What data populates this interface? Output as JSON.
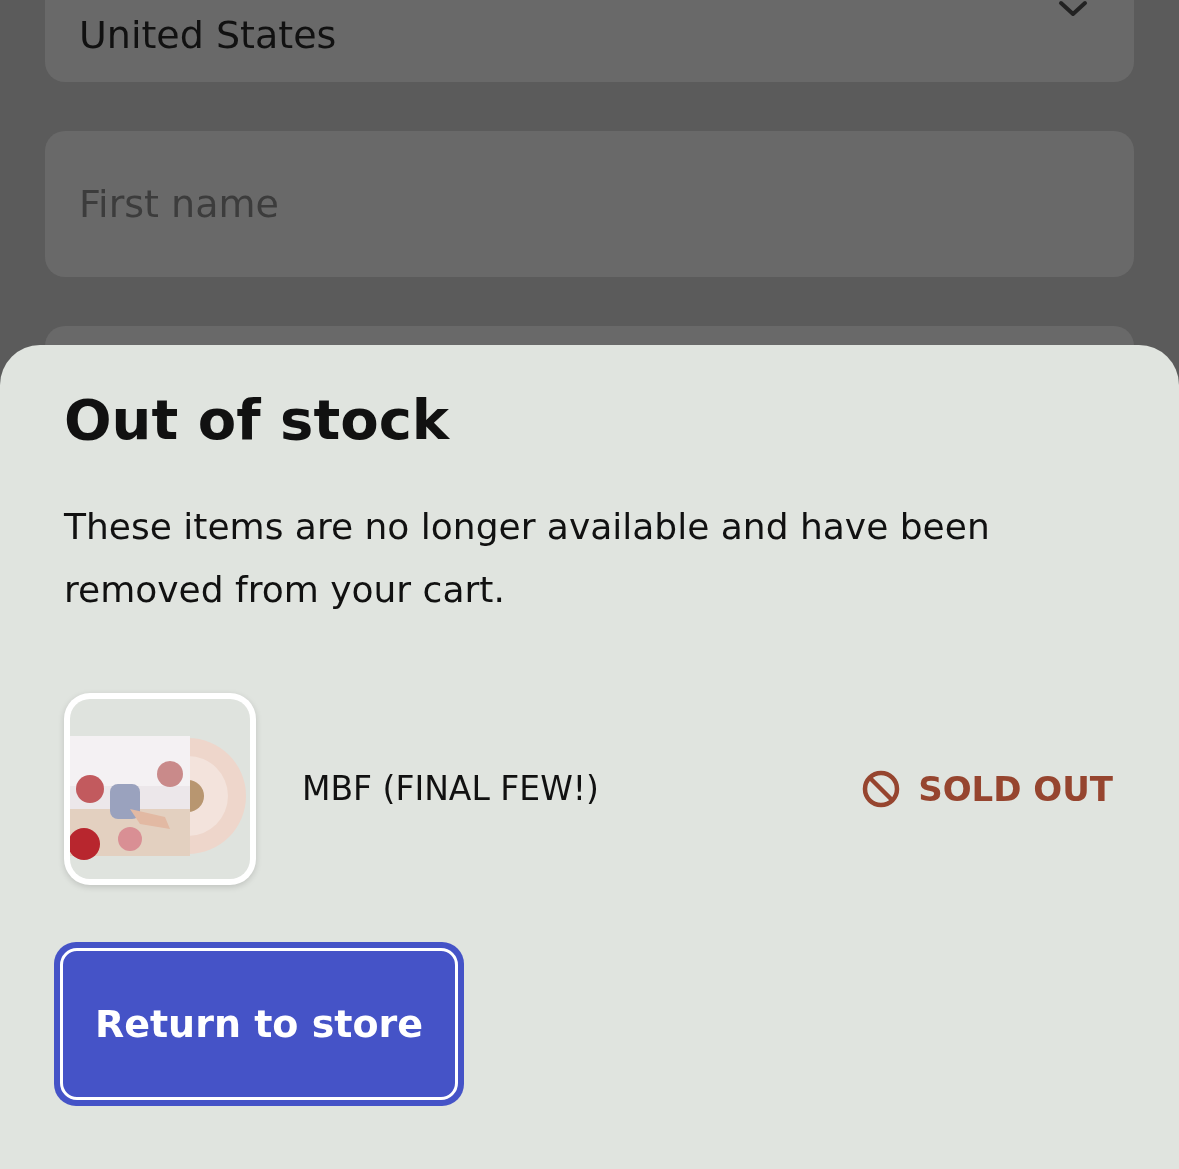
{
  "background_form": {
    "fields": [
      {
        "kind": "select",
        "value": "United States"
      },
      {
        "kind": "text",
        "placeholder": "First name"
      },
      {
        "kind": "text"
      }
    ]
  },
  "dialog": {
    "title": "Out of stock",
    "message": "These items are no longer available and have been removed from your cart.",
    "items": [
      {
        "name": "MBF (FINAL FEW!)",
        "status": "SOLD OUT"
      }
    ],
    "button": "Return to store"
  }
}
